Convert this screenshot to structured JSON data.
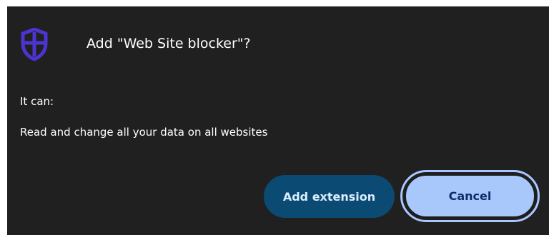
{
  "dialog": {
    "title": "Add \"Web Site blocker\"?",
    "it_can_label": "It can:",
    "permissions": [
      "Read and change all your data on all websites"
    ],
    "icon": "shield-icon",
    "icon_color": "#4b34d1"
  },
  "buttons": {
    "add_label": "Add extension",
    "cancel_label": "Cancel",
    "add_color": "#0b4a72",
    "cancel_color": "#a8c7fa"
  }
}
